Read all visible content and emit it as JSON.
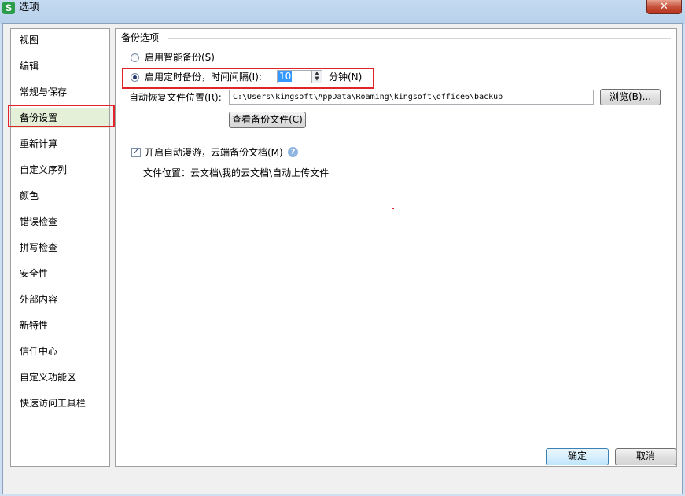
{
  "window": {
    "title": "选项",
    "app_icon": "S",
    "close_label": "✕"
  },
  "nav": {
    "items": [
      {
        "label": "视图"
      },
      {
        "label": "编辑"
      },
      {
        "label": "常规与保存"
      },
      {
        "label": "备份设置",
        "selected": true
      },
      {
        "label": "重新计算"
      },
      {
        "label": "自定义序列"
      },
      {
        "label": "颜色"
      },
      {
        "label": "错误检查"
      },
      {
        "label": "拼写检查"
      },
      {
        "label": "安全性"
      },
      {
        "label": "外部内容"
      },
      {
        "label": "新特性"
      },
      {
        "label": "信任中心"
      },
      {
        "label": "自定义功能区"
      },
      {
        "label": "快速访问工具栏"
      }
    ]
  },
  "backup": {
    "group_title": "备份选项",
    "smart_backup_label": "启用智能备份(S)",
    "timed_backup_label": "启用定时备份，时间间隔(I):",
    "interval_value": "10",
    "interval_unit": "分钟(N)",
    "recovery_path_label": "自动恢复文件位置(R):",
    "recovery_path_value": "C:\\Users\\kingsoft\\AppData\\Roaming\\kingsoft\\office6\\backup",
    "browse_label": "浏览(B)...",
    "view_backup_label": "查看备份文件(C)",
    "cloud_roaming_label": "开启自动漫游，云端备份文档(M)",
    "cloud_roaming_checked": true,
    "file_location_text": "文件位置：云文档\\我的云文档\\自动上传文件"
  },
  "footer": {
    "ok_label": "确定",
    "cancel_label": "取消"
  },
  "colors": {
    "highlight_red": "#e0242a",
    "selected_bg": "#e4f1d8"
  }
}
